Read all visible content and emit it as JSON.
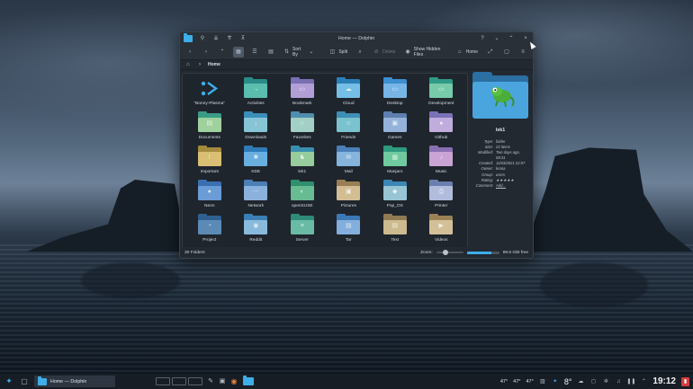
{
  "window": {
    "title": "Home — Dolphin",
    "toolbar": {
      "sort_label": "Sort By",
      "split_label": "Split",
      "delete_label": "Delete",
      "hidden_label": "Show Hidden Files",
      "home_label": "Home"
    },
    "breadcrumb": {
      "current": "Home"
    },
    "items": [
      {
        "label": "\"Bonny-Plasma\"",
        "back": "#1f3b52",
        "front": "#1f3b52",
        "emb": "⬩",
        "special": true
      },
      {
        "label": "Activities",
        "back": "#2a8c88",
        "front": "#5fc1b1",
        "emb": "→"
      },
      {
        "label": "Bookmark",
        "back": "#7a6fb3",
        "front": "#b6a3d9",
        "emb": "▭"
      },
      {
        "label": "Cloud",
        "back": "#2b7fb8",
        "front": "#7cc3e8",
        "emb": "☁"
      },
      {
        "label": "Desktop",
        "back": "#3c8fd0",
        "front": "#7db9e8",
        "emb": "▭"
      },
      {
        "label": "Development",
        "back": "#2f9a86",
        "front": "#7fcfae",
        "emb": "▭"
      },
      {
        "label": "Documents",
        "back": "#3c9b86",
        "front": "#a8d6a0",
        "emb": "▤"
      },
      {
        "label": "Downloads",
        "back": "#3a8fb8",
        "front": "#8ec9d8",
        "emb": "↓"
      },
      {
        "label": "Favorites",
        "back": "#4e8fb0",
        "front": "#a9d5c8",
        "emb": "☆"
      },
      {
        "label": "Friends",
        "back": "#3d8fb6",
        "front": "#7fc7cf",
        "emb": "☺"
      },
      {
        "label": "Games",
        "back": "#5d7fb0",
        "front": "#9ab7dd",
        "emb": "▣"
      },
      {
        "label": "Github",
        "back": "#7a72b8",
        "front": "#c5b2df",
        "emb": "●"
      },
      {
        "label": "Important",
        "back": "#a38a3c",
        "front": "#dcc37a",
        "emb": "!"
      },
      {
        "label": "KDE",
        "back": "#2f7bb8",
        "front": "#6fb2e3",
        "emb": "✱"
      },
      {
        "label": "lek1",
        "back": "#3a8fb0",
        "front": "#9fd19b",
        "emb": "♞"
      },
      {
        "label": "Mail",
        "back": "#4a7fb8",
        "front": "#8ab8e0",
        "emb": "✉"
      },
      {
        "label": "Manjaro",
        "back": "#2e9a7e",
        "front": "#75cfa2",
        "emb": "▦"
      },
      {
        "label": "Music",
        "back": "#8a6fb3",
        "front": "#cfa8d8",
        "emb": "♪"
      },
      {
        "label": "Neon",
        "back": "#3a6fb0",
        "front": "#6fa0d8",
        "emb": "●"
      },
      {
        "label": "Network",
        "back": "#4b7fb5",
        "front": "#8fb6df",
        "emb": "⋯"
      },
      {
        "label": "openSUSE",
        "back": "#2f8f6e",
        "front": "#6fbf96",
        "emb": "◐"
      },
      {
        "label": "Pictures",
        "back": "#9a7f54",
        "front": "#d8c39a",
        "emb": "▣"
      },
      {
        "label": "Pop_OS",
        "back": "#3b86b6",
        "front": "#9fcbd6",
        "emb": "◆"
      },
      {
        "label": "Printer",
        "back": "#6a7fb0",
        "front": "#b7c0df",
        "emb": "⎙"
      },
      {
        "label": "Project",
        "back": "#2f5f8f",
        "front": "#5f8fb8",
        "emb": "◔"
      },
      {
        "label": "Reddit",
        "back": "#3b7fb6",
        "front": "#8fbfe0",
        "emb": "◉"
      },
      {
        "label": "Server",
        "back": "#2f8a7a",
        "front": "#6fbfa8",
        "emb": "≡"
      },
      {
        "label": "Tar",
        "back": "#3b79b6",
        "front": "#8bb3e0",
        "emb": "▤"
      },
      {
        "label": "Text",
        "back": "#8f7a54",
        "front": "#d2bf94",
        "emb": "▤"
      },
      {
        "label": "Videos",
        "back": "#9a8256",
        "front": "#d8c69e",
        "emb": "▶"
      }
    ],
    "info": {
      "name": "lek1",
      "props": [
        {
          "key": "Type:",
          "value": "folder"
        },
        {
          "key": "Size:",
          "value": "22 items"
        },
        {
          "key": "Modified:",
          "value": "Two days ago, 08:31"
        },
        {
          "key": "Created:",
          "value": "11/03/2021 22:07"
        },
        {
          "key": "Owner:",
          "value": "krona"
        },
        {
          "key": "Group:",
          "value": "users"
        }
      ],
      "rating_label": "Rating:",
      "rating_stars": "★★★★★",
      "comment_label": "Comment:",
      "comment_link": "Add..."
    },
    "status": {
      "count": "30 Folders",
      "zoom_label": "Zoom:",
      "zoom_level": 0.3,
      "free_space": "89.6 GiB free",
      "used_fraction": 0.75
    }
  },
  "taskbar": {
    "task_title": "Home — Dolphin",
    "temps": [
      "47°",
      "47°",
      "47°"
    ],
    "weather_temp": "8°",
    "clock": "19:12"
  },
  "colors": {
    "accent": "#3daee9"
  }
}
